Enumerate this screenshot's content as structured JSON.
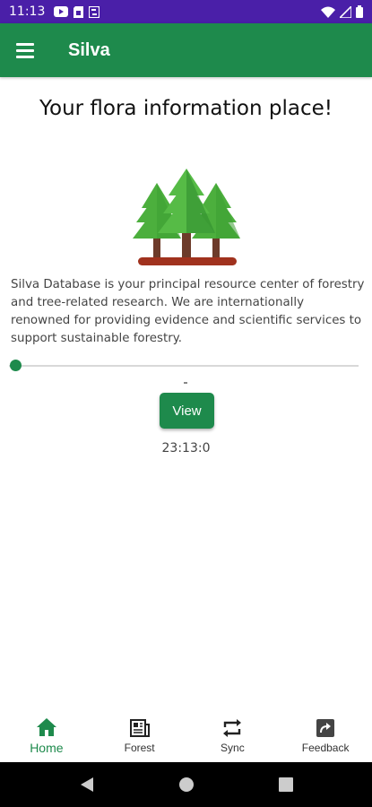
{
  "status_bar": {
    "time": "11:13",
    "left_icons": [
      "youtube-icon",
      "sim-card-icon",
      "sync-badge-icon"
    ],
    "right_icons": [
      "wifi-icon",
      "signal-icon",
      "battery-icon"
    ],
    "color": "#4a1fa8"
  },
  "app_bar": {
    "title": "Silva",
    "menu_icon": "hamburger-menu-icon",
    "color": "#1e8a4c"
  },
  "home": {
    "headline": "Your flora information place!",
    "description": "Silva Database is your principal resource center of forestry and tree-related research. We are internationally renowned for providing evidence and scientific services to support sustainable forestry.",
    "slider_value": 0,
    "view_button_label": "View",
    "timer": "23:13:0"
  },
  "bottom_nav": {
    "items": [
      {
        "label": "Home",
        "icon": "home-icon",
        "active": true
      },
      {
        "label": "Forest",
        "icon": "newspaper-icon",
        "active": false
      },
      {
        "label": "Sync",
        "icon": "sync-icon",
        "active": false
      },
      {
        "label": "Feedback",
        "icon": "feedback-icon",
        "active": false
      }
    ]
  },
  "system_nav": [
    "back-icon",
    "home-circle-icon",
    "recents-icon"
  ],
  "colors": {
    "accent": "#1e8a4c",
    "tree_light": "#4caf3d",
    "tree_dark": "#2e8b2e",
    "trunk": "#6d3b2a",
    "ground": "#a0321e"
  }
}
